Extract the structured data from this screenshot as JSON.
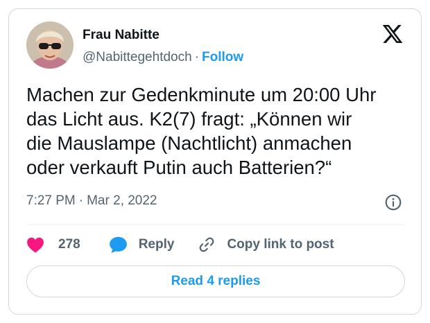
{
  "author": {
    "name": "Frau Nabitte",
    "handle": "@Nabittegehtdoch",
    "separator": "·",
    "follow_label": "Follow",
    "avatar_icon": "profile-photo"
  },
  "brand": {
    "logo_icon": "x-logo-icon"
  },
  "tweet": {
    "text": "Machen zur Gedenkminute um 20:00 Uhr\ndas Licht aus. K2(7) fragt: „Können wir\ndie Mauslampe (Nachtlicht) anmachen\noder verkauft Putin auch Batterien?“",
    "time": "7:27 PM",
    "separator": "·",
    "date": "Mar 2, 2022"
  },
  "actions": {
    "like_count": "278",
    "reply_label": "Reply",
    "copy_label": "Copy link to post",
    "like_icon": "heart-icon",
    "reply_icon": "speech-bubble-icon",
    "copy_icon": "link-icon",
    "info_icon": "info-icon"
  },
  "footer": {
    "read_replies_label": "Read 4 replies"
  },
  "colors": {
    "accent": "#1d9bf0",
    "like": "#f91880",
    "text": "#0f1419",
    "muted": "#536471",
    "border": "#cfd9de"
  }
}
